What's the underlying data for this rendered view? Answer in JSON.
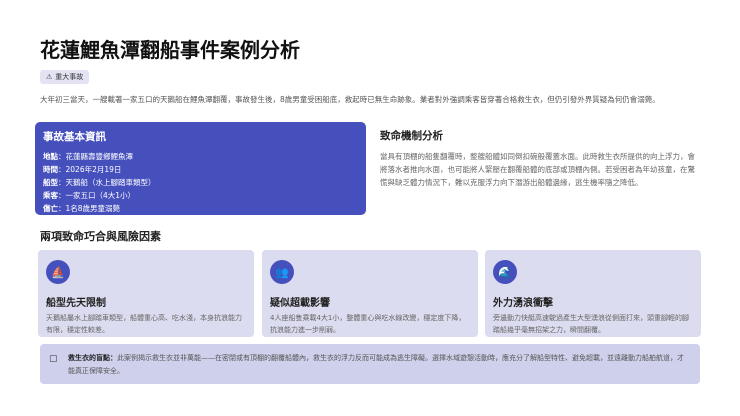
{
  "title": "花蓮鯉魚潭翻船事件案例分析",
  "badge": {
    "icon": "warning-icon",
    "label": "重大事故"
  },
  "intro": "大年初三當天，一艘載著一家五口的天鵝船在鯉魚潭翻覆，事故發生後，8歲男童受困船底，救起時已無生命跡象。業者對外強調乘客皆穿著合格救生衣，但仍引發外界質疑為何仍會溺斃。",
  "info": {
    "heading": "事故基本資訊",
    "rows": [
      {
        "k": "地點",
        "v": "花蓮縣壽豐鄉鯉魚潭"
      },
      {
        "k": "時間",
        "v": "2026年2月19日"
      },
      {
        "k": "船型",
        "v": "天鵝船（水上腳踏車類型）"
      },
      {
        "k": "乘客",
        "v": "一家五口（4大1小）"
      },
      {
        "k": "傷亡",
        "v": "1名8歲男童溺斃"
      }
    ]
  },
  "analysis": {
    "heading": "致命機制分析",
    "text": "當具有頂棚的船隻翻覆時，整艘船體如同倒扣碗般覆蓋水面。此時救生衣所提供的向上浮力，會將落水者推向水面，也可能將人緊壓在翻覆船體的底部或頂棚內側。若受困者為年幼孩童，在驚慌與缺乏體力情況下，難以克服浮力向下潛游出船體邊緣，逃生機率隨之降低。"
  },
  "section_title": "兩項致命巧合與風險因素",
  "cards": [
    {
      "icon": "boat-icon",
      "title": "船型先天限制",
      "text": "天鵝船屬水上腳踏車類型，船體重心高、吃水淺，本身抗浪能力有限，穩定性較差。"
    },
    {
      "icon": "people-icon",
      "title": "疑似超載影響",
      "text": "4人座船隻乘載4大1小，整體重心與吃水線改變，穩定度下降，抗浪能力進一步削弱。"
    },
    {
      "icon": "wave-icon",
      "title": "外力湧浪衝擊",
      "text": "旁邊動力快艇高速駛過產生大型湧浪從側面打來，頭重腳輕的腳踏船幾乎毫無招架之力，瞬間翻覆。"
    }
  ],
  "note": {
    "icon": "note-icon",
    "bold": "救生衣的盲點：",
    "text": "此案例揭示救生衣並非萬能——在密閉或有頂棚的翻覆船體內，救生衣的浮力反而可能成為逃生障礙。選擇水域遊憩活動時，應充分了解船型特性、避免超載，並遠離動力船舶航道，才能真正保障安全。"
  }
}
